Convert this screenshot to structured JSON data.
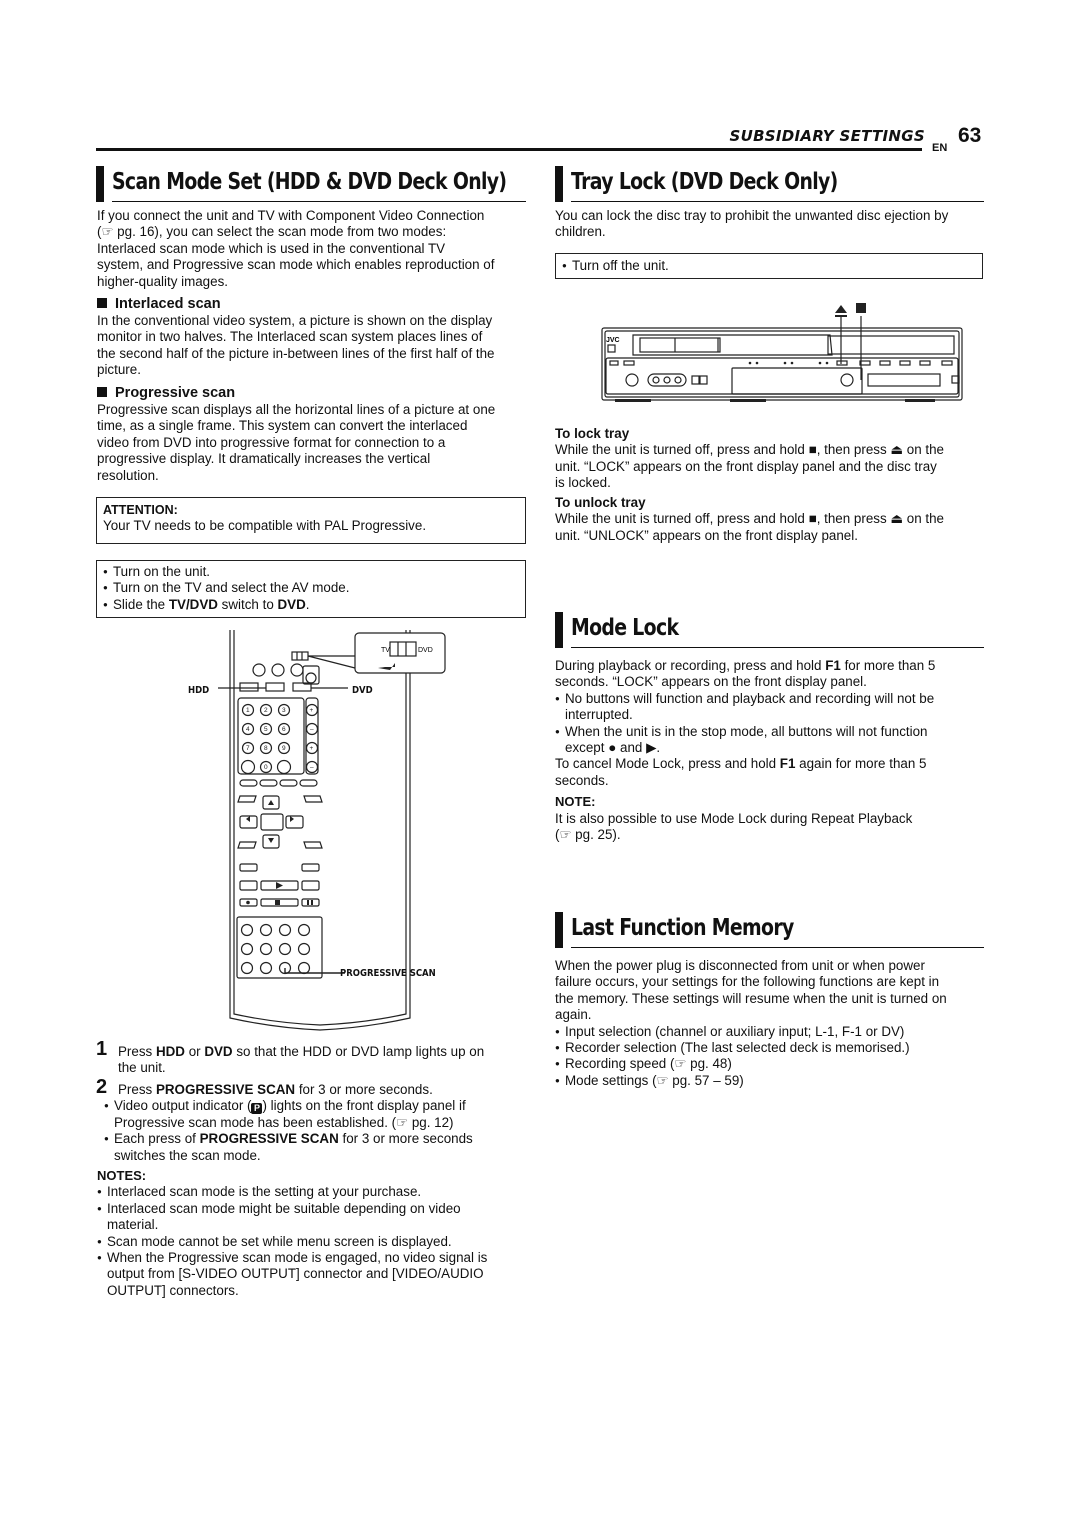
{
  "header": {
    "section_title": "SUBSIDIARY SETTINGS",
    "lang": "EN",
    "page_number": "63"
  },
  "scan_mode": {
    "title": "Scan Mode Set (HDD & DVD Deck Only)",
    "intro_1": "If you connect the unit and TV with Component Video Connection",
    "intro_2": "(☞ pg. 16), you can select the scan mode from two modes:",
    "intro_3": "Interlaced scan mode which is used in the conventional TV",
    "intro_4": "system, and Progressive scan mode which enables reproduction of",
    "intro_5": "higher-quality images.",
    "interlaced": {
      "heading": "Interlaced scan",
      "lines": [
        "In the conventional video system, a picture is shown on the display",
        "monitor in two halves. The Interlaced scan system places lines of",
        "the second half of the picture in-between lines of the first half of the",
        "picture."
      ]
    },
    "progressive": {
      "heading": "Progressive scan",
      "lines": [
        "Progressive scan displays all the horizontal lines of a picture at one",
        "time, as a single frame. This system can convert the interlaced",
        "video from DVD into progressive format for connection to a",
        "progressive display. It dramatically increases the vertical",
        "resolution."
      ]
    },
    "attention": {
      "title": "ATTENTION:",
      "text": "Your TV needs to be compatible with PAL Progressive."
    },
    "prep": {
      "item1": "Turn on the unit.",
      "item2": "Turn on the TV and select the AV mode.",
      "item3_pre": "Slide the ",
      "item3_b1": "TV/DVD",
      "item3_mid": " switch to ",
      "item3_b2": "DVD",
      "item3_post": "."
    },
    "remote_labels": {
      "hdd": "HDD",
      "dvd": "DVD",
      "progressive_scan": "PROGRESSIVE SCAN",
      "switch_tv": "TV",
      "switch_dvd": "DVD"
    },
    "steps": {
      "s1_num": "1",
      "s1_pre": "Press ",
      "s1_b1": "HDD",
      "s1_mid": " or ",
      "s1_b2": "DVD",
      "s1_post": " so that the HDD or DVD lamp lights up on",
      "s1_line2": "the unit.",
      "s2_num": "2",
      "s2_pre": "Press ",
      "s2_b": "PROGRESSIVE SCAN",
      "s2_post": " for 3 or more seconds.",
      "s2_b1_pre": "Video output indicator (",
      "s2_b1_icon": "P",
      "s2_b1_post": ") lights on the front display panel if",
      "s2_b1_line2": "Progressive scan mode has been established. (☞ pg. 12)",
      "s2_b2_pre": "Each press of ",
      "s2_b2_b": "PROGRESSIVE SCAN",
      "s2_b2_post": " for 3 or more seconds",
      "s2_b2_line2": "switches the scan mode."
    },
    "notes": {
      "title": "NOTES:",
      "n1": "Interlaced scan mode is the setting at your purchase.",
      "n2a": "Interlaced scan mode might be suitable depending on video",
      "n2b": "material.",
      "n3": "Scan mode cannot be set while menu screen is displayed.",
      "n4a": "When the Progressive scan mode is engaged, no video signal is",
      "n4b": "output from [S-VIDEO OUTPUT] connector and [VIDEO/AUDIO",
      "n4c": "OUTPUT] connectors."
    }
  },
  "tray_lock": {
    "title": "Tray Lock (DVD Deck Only)",
    "intro_1": "You can lock the disc tray to prohibit the unwanted disc ejection by",
    "intro_2": "children.",
    "prep": "Turn off the unit.",
    "device_brand": "JVC",
    "lock": {
      "heading": "To lock tray",
      "l1_pre": "While the unit is turned off, press and hold ",
      "l1_mid": ", then press ",
      "l1_post": " on the",
      "l2": "unit. “LOCK” appears on the front display panel and the disc tray",
      "l3": "is locked."
    },
    "unlock": {
      "heading": "To unlock tray",
      "l1_pre": "While the unit is turned off, press and hold ",
      "l1_mid": ", then press ",
      "l1_post": " on the",
      "l2": "unit. “UNLOCK” appears on the front display panel."
    }
  },
  "mode_lock": {
    "title": "Mode Lock",
    "p1_pre": "During playback or recording, press and hold ",
    "p1_b": "F1",
    "p1_post": " for more than 5",
    "p1_line2": "seconds. “LOCK” appears on the front display panel.",
    "b1a": "No buttons will function and playback and recording will not be",
    "b1b": "interrupted.",
    "b2a": "When the unit is in the stop mode, all buttons will not function",
    "b2b_pre": "except ",
    "b2b_mid": " and ",
    "b2b_post": ".",
    "p2_pre": "To cancel Mode Lock, press and hold ",
    "p2_b": "F1",
    "p2_post": " again for more than 5",
    "p2_line2": "seconds.",
    "note_title": "NOTE:",
    "note_l1": "It is also possible to use Mode Lock during Repeat Playback",
    "note_l2": "(☞ pg. 25)."
  },
  "last_function": {
    "title": "Last Function Memory",
    "lines": [
      "When the power plug is disconnected from unit or when power",
      "failure occurs, your settings for the following functions are kept in",
      "the memory. These settings will resume when the unit is turned on",
      "again."
    ],
    "items": [
      "Input selection (channel or auxiliary input; L-1, F-1 or DV)",
      "Recorder selection (The last selected deck is memorised.)",
      "Recording speed (☞ pg. 48)",
      "Mode settings (☞ pg. 57 – 59)"
    ]
  }
}
